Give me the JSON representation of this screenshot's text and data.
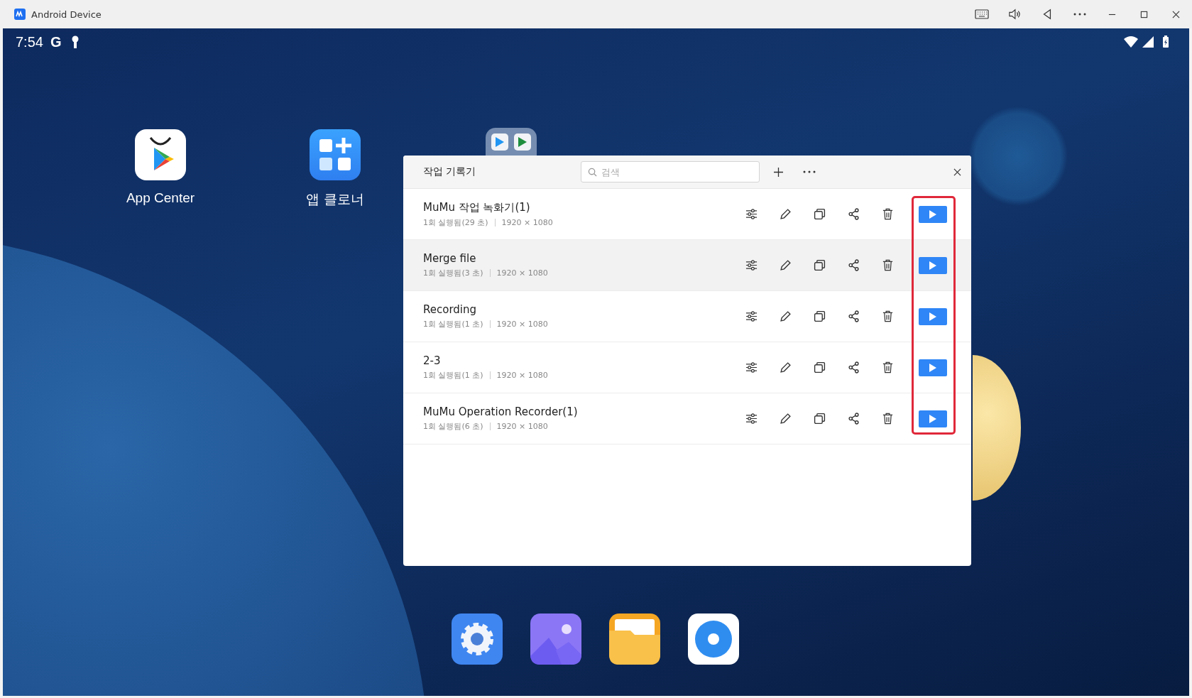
{
  "window": {
    "title": "Android Device"
  },
  "status_bar": {
    "time": "7:54",
    "account_letter": "G"
  },
  "desktop_icons": [
    {
      "kind": "store",
      "label": "App Center"
    },
    {
      "kind": "cloner",
      "label": "앱 클로너"
    },
    {
      "kind": "folder"
    }
  ],
  "dock": [
    {
      "kind": "settings"
    },
    {
      "kind": "gallery"
    },
    {
      "kind": "files"
    },
    {
      "kind": "browser"
    }
  ],
  "dialog": {
    "title": "작업 기록기",
    "search": {
      "placeholder": "검색"
    },
    "play_column_outlined": true,
    "rows": [
      {
        "name": "MuMu 작업 녹화기(1)",
        "runs": "1회 실행됨(29 초)",
        "resolution": "1920 × 1080",
        "selected": false
      },
      {
        "name": "Merge file",
        "runs": "1회 실행됨(3 초)",
        "resolution": "1920 × 1080",
        "selected": true
      },
      {
        "name": "Recording",
        "runs": "1회 실행됨(1 초)",
        "resolution": "1920 × 1080",
        "selected": false
      },
      {
        "name": "2-3",
        "runs": "1회 실행됨(1 초)",
        "resolution": "1920 × 1080",
        "selected": false
      },
      {
        "name": "MuMu Operation Recorder(1)",
        "runs": "1회 실행됨(6 초)",
        "resolution": "1920 × 1080",
        "selected": false
      }
    ]
  }
}
